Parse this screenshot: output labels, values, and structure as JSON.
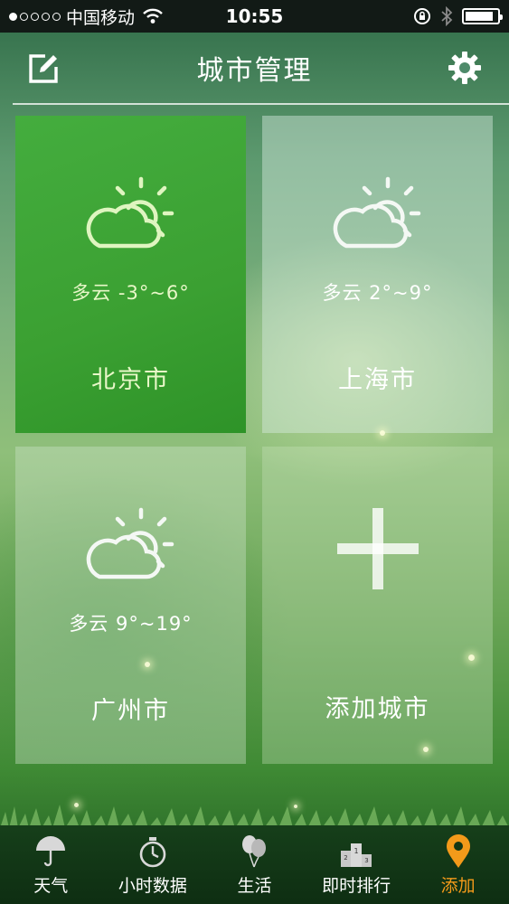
{
  "status_bar": {
    "carrier": "中国移动",
    "time": "10:55"
  },
  "nav": {
    "title": "城市管理",
    "edit_icon": "edit-icon",
    "settings_icon": "gear-icon"
  },
  "cities": [
    {
      "condition": "多云",
      "temp": "-3°~6°",
      "name": "北京市",
      "icon": "partly-cloudy-icon"
    },
    {
      "condition": "多云",
      "temp": "2°~9°",
      "name": "上海市",
      "icon": "partly-cloudy-icon"
    },
    {
      "condition": "多云",
      "temp": "9°~19°",
      "name": "广州市",
      "icon": "partly-cloudy-icon"
    }
  ],
  "add_city": {
    "label": "添加城市",
    "icon": "plus-icon"
  },
  "tabs": [
    {
      "label": "天气",
      "icon": "umbrella-icon"
    },
    {
      "label": "小时数据",
      "icon": "stopwatch-icon"
    },
    {
      "label": "生活",
      "icon": "balloons-icon"
    },
    {
      "label": "即时排行",
      "icon": "podium-icon"
    },
    {
      "label": "添加",
      "icon": "location-pin-icon",
      "active": true
    }
  ],
  "colors": {
    "active_tab": "#f39a1a",
    "selected_tile": "#3ba032"
  }
}
